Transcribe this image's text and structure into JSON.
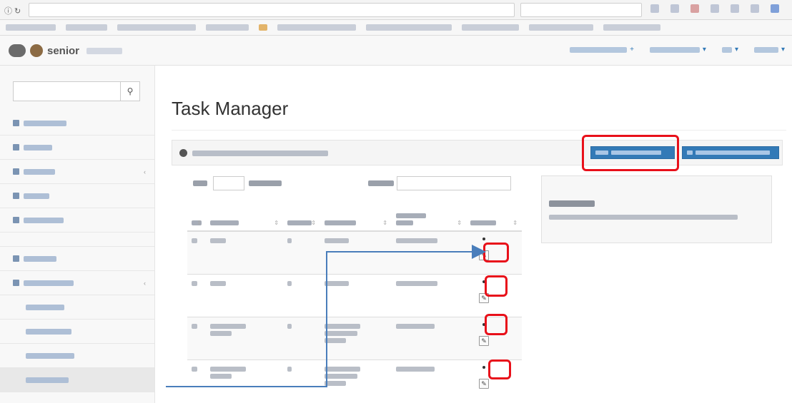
{
  "browser": {
    "url": "",
    "search_placeholder": ""
  },
  "navbar": {
    "brand": "senior",
    "links": [
      "",
      "",
      "",
      ""
    ]
  },
  "sidebar": {
    "search_placeholder": "",
    "items": [
      {
        "label": "",
        "type": "top"
      },
      {
        "label": "",
        "type": "top"
      },
      {
        "label": "",
        "type": "top",
        "caret": true
      },
      {
        "label": "",
        "type": "top"
      },
      {
        "label": "",
        "type": "top"
      },
      {
        "label": "",
        "type": "gap"
      },
      {
        "label": "",
        "type": "top"
      },
      {
        "label": "",
        "type": "top",
        "caret": true
      },
      {
        "label": "",
        "type": "sub"
      },
      {
        "label": "",
        "type": "sub"
      },
      {
        "label": "",
        "type": "sub"
      },
      {
        "label": "",
        "type": "sub",
        "active": true
      }
    ]
  },
  "main": {
    "title": "Task Manager",
    "panel_heading": "",
    "buttons": [
      "",
      ""
    ],
    "table_controls": {
      "show_value": ""
    },
    "table": {
      "columns": [
        "",
        "",
        "",
        "",
        "",
        ""
      ],
      "rows": [
        {
          "id": "",
          "filename": "",
          "version": "",
          "comment": "",
          "date": ""
        },
        {
          "id": "",
          "filename": "",
          "version": "",
          "comment": "",
          "date": ""
        },
        {
          "id": "",
          "filename": "",
          "version": "",
          "comment": "",
          "date": ""
        },
        {
          "id": "",
          "filename": "",
          "version": "",
          "comment": "",
          "date": ""
        }
      ]
    },
    "preview": {
      "title": "",
      "body": ""
    }
  },
  "colors": {
    "accent": "#337ab7",
    "annotation": "#e8101a",
    "arrow": "#4a7ebb"
  }
}
